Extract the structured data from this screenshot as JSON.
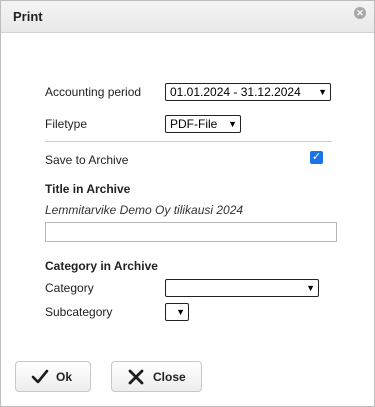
{
  "dialog": {
    "title": "Print",
    "close_icon": "⊗"
  },
  "form": {
    "accounting_period_label": "Accounting period",
    "accounting_period_value": "01.01.2024 - 31.12.2024",
    "filetype_label": "Filetype",
    "filetype_value": "PDF-File",
    "save_to_archive_label": "Save to Archive",
    "save_to_archive_checked": true,
    "title_in_archive_heading": "Title in Archive",
    "title_in_archive_value": "Lemmitarvike Demo Oy tilikausi 2024",
    "title_in_archive_input_value": "",
    "category_in_archive_heading": "Category in Archive",
    "category_label": "Category",
    "category_value": "",
    "subcategory_label": "Subcategory",
    "subcategory_value": ""
  },
  "buttons": {
    "ok_label": "Ok",
    "close_label": "Close"
  },
  "colors": {
    "checkbox_accent": "#1a73e8",
    "titlebar_bg": "#eeeeee"
  }
}
